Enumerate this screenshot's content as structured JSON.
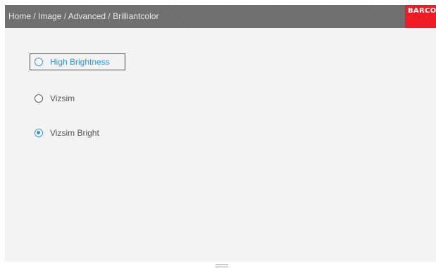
{
  "header": {
    "breadcrumb": "Home / Image / Advanced / Brilliantcolor",
    "logo_text": "BARCO",
    "background_color": "#6d6d6d",
    "logo_color": "#ee1c25"
  },
  "options": [
    {
      "label": "High Brightness",
      "selected": false,
      "focused": true
    },
    {
      "label": "Vizsim",
      "selected": false,
      "focused": false
    },
    {
      "label": "Vizsim Bright",
      "selected": true,
      "focused": false
    }
  ],
  "colors": {
    "accent": "#2e96e0",
    "panel_background": "#f3f3f3"
  },
  "bottom_handle_icon": "drag-handle-icon"
}
